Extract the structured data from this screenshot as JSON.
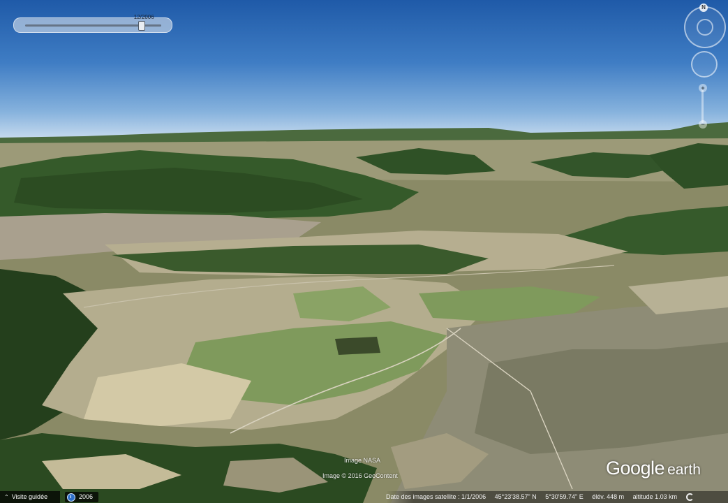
{
  "time_slider": {
    "date_label": "12/2006",
    "position_fraction": 0.85
  },
  "navigation": {
    "north_label": "N"
  },
  "attribution": {
    "line1": "Image NASA",
    "line2": "Image © 2016 GeoContent"
  },
  "logo": {
    "google": "Google",
    "earth": "earth"
  },
  "bottom_bar": {
    "tour_label": "Visite guidée",
    "history_year": "2006",
    "imagery_date": "Date des images satellite : 1/1/2006",
    "latitude": "45°23'38.57\" N",
    "longitude": "5°30'59.74\" E",
    "elevation": "élév.  448 m",
    "altitude": "altitude   1.03 km"
  },
  "colors": {
    "sky_top": "#1f5aa8",
    "sky_horizon": "#c9dcef",
    "forest": "#2f4d22",
    "field_light": "#c9c3a2",
    "field_green": "#7f9a5c"
  },
  "icons": [
    "north-arrow-icon",
    "look-joystick-icon",
    "move-joystick-icon",
    "zoom-in-icon",
    "zoom-out-icon",
    "chevron-up-icon",
    "clock-icon",
    "streaming-icon"
  ]
}
